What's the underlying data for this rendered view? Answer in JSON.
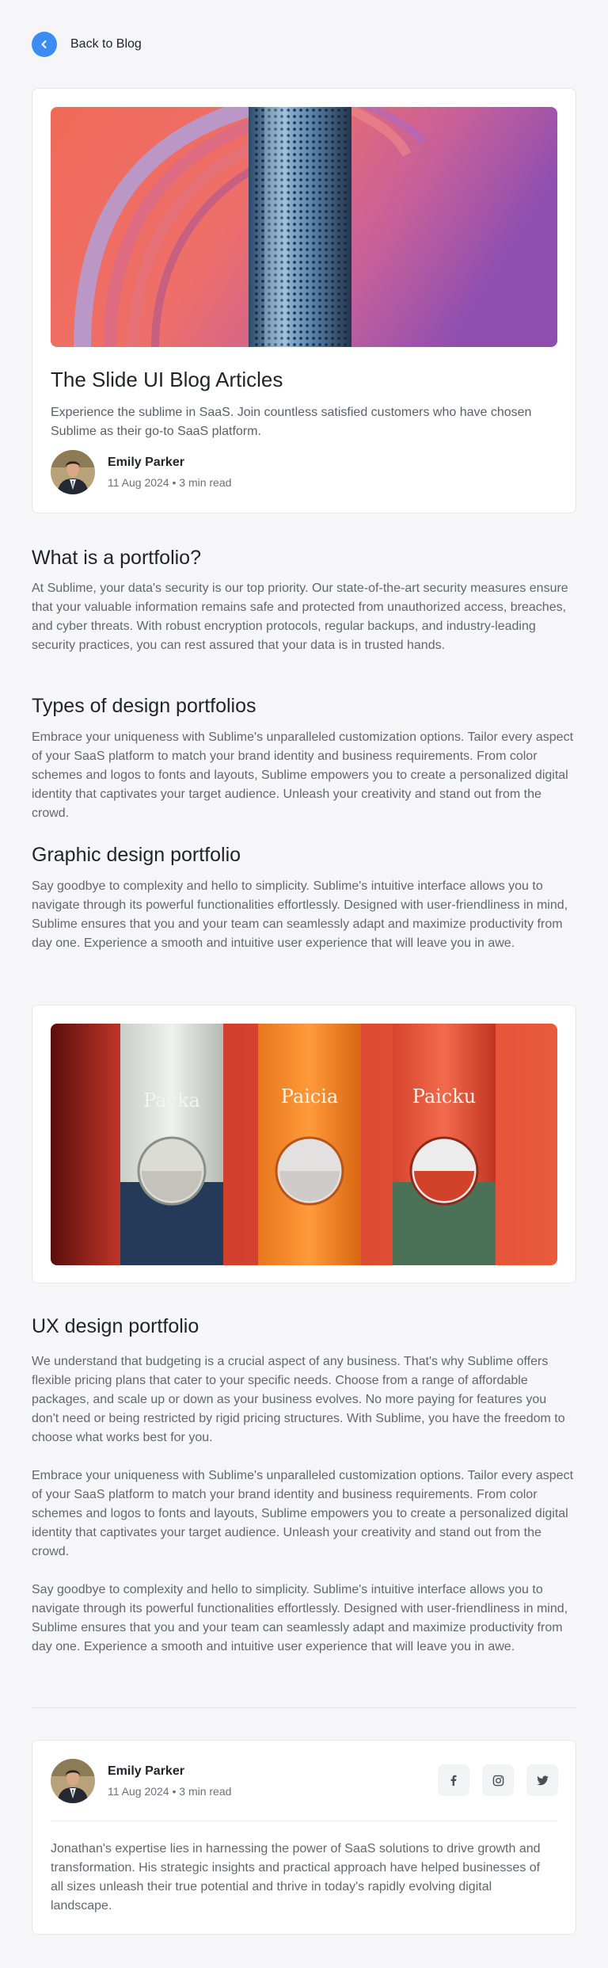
{
  "nav": {
    "back_label": "Back to Blog"
  },
  "post": {
    "title": "The Slide UI Blog Articles",
    "subtitle": "Experience the sublime in SaaS. Join countless satisfied customers who have chosen Sublime as their go-to SaaS platform.",
    "author": "Emily Parker",
    "meta": "11 Aug 2024 • 3 min read"
  },
  "sections": [
    {
      "heading": "What is a portfolio?",
      "paragraphs": [
        "At Sublime, your data's security is our top priority. Our state-of-the-art security measures ensure that your valuable information remains safe and protected from unauthorized access, breaches, and cyber threats. With robust encryption protocols, regular backups, and industry-leading security practices, you can rest assured that your data is in trusted hands."
      ]
    },
    {
      "heading": "Types of design portfolios",
      "paragraphs": [
        "Embrace your uniqueness with Sublime's unparalleled customization options. Tailor every aspect of your SaaS platform to match your brand identity and business requirements. From color schemes and logos to fonts and layouts, Sublime empowers you to create a personalized digital identity that captivates your target audience. Unleash your creativity and stand out from the crowd."
      ]
    },
    {
      "heading": "Graphic design portfolio",
      "paragraphs": [
        "Say goodbye to complexity and hello to simplicity. Sublime's intuitive interface allows you to navigate through its powerful functionalities effortlessly. Designed with user-friendliness in mind, Sublime ensures that you and your team can seamlessly adapt and maximize productivity from day one. Experience a smooth and intuitive user experience that will leave you in awe."
      ]
    },
    {
      "heading": "UX design portfolio",
      "paragraphs": [
        "We understand that budgeting is a crucial aspect of any business. That's why Sublime offers flexible pricing plans that cater to your specific needs. Choose from a range of affordable packages, and scale up or down as your business evolves. No more paying for features you don't need or being restricted by rigid pricing structures. With Sublime, you have the freedom to choose what works best for you.",
        "Embrace your uniqueness with Sublime's unparalleled customization options. Tailor every aspect of your SaaS platform to match your brand identity and business requirements. From color schemes and logos to fonts and layouts, Sublime empowers you to create a personalized digital identity that captivates your target audience. Unleash your creativity and stand out from the crowd.",
        "Say goodbye to complexity and hello to simplicity. Sublime's intuitive interface allows you to navigate through its powerful functionalities effortlessly. Designed with user-friendliness in mind, Sublime ensures that you and your team can seamlessly adapt and maximize productivity from day one. Experience a smooth and intuitive user experience that will leave you in awe."
      ]
    }
  ],
  "product_labels": [
    "Packa",
    "Paicia",
    "Paicku"
  ],
  "author_card": {
    "name": "Emily Parker",
    "meta": "11 Aug 2024 • 3 min read",
    "bio": "Jonathan's expertise lies in harnessing the power of SaaS solutions to drive growth and transformation. His strategic insights and practical approach have helped businesses of all sizes unleash their true potential and thrive in today's rapidly evolving digital landscape.",
    "socials": [
      "facebook-icon",
      "instagram-icon",
      "twitter-icon"
    ]
  },
  "colors": {
    "accent": "#3b8df2",
    "background": "#f6f6f8",
    "card": "#ffffff"
  }
}
